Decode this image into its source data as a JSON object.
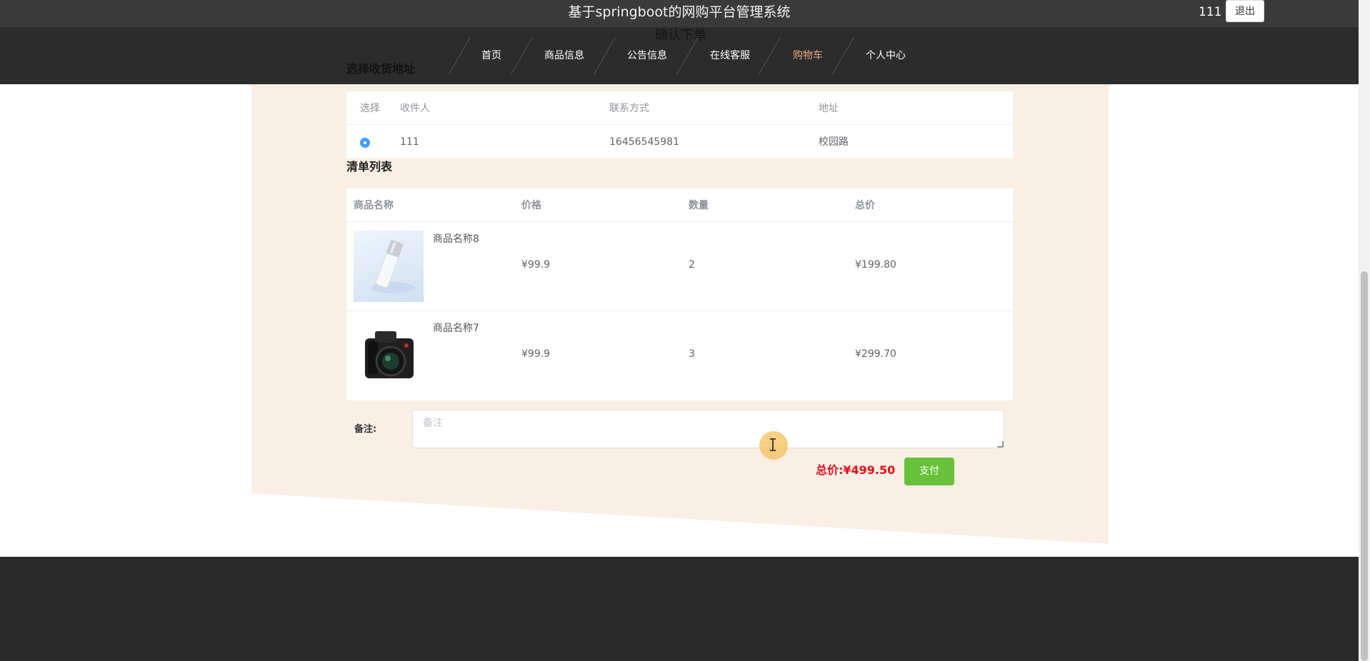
{
  "header": {
    "title": "基于springboot的网购平台管理系统",
    "username": "111",
    "logout_label": "退出"
  },
  "nav": {
    "items": [
      {
        "label": "首页"
      },
      {
        "label": "商品信息"
      },
      {
        "label": "公告信息"
      },
      {
        "label": "在线客服"
      },
      {
        "label": "购物车",
        "active": true
      },
      {
        "label": "个人中心"
      }
    ],
    "active_color": "#e9a97f",
    "ghost_heading": "确认下单"
  },
  "address_section": {
    "title": "选择收货地址",
    "columns": [
      "选择",
      "收件人",
      "联系方式",
      "地址"
    ],
    "rows": [
      {
        "selected": true,
        "recipient": "111",
        "phone": "16456545981",
        "address": "校园路"
      }
    ]
  },
  "order_section": {
    "title": "清单列表",
    "columns": [
      "商品名称",
      "价格",
      "数量",
      "总价"
    ],
    "items": [
      {
        "name": "商品名称8",
        "price": "¥99.9",
        "quantity": "2",
        "total": "¥199.80",
        "image": "bottle-product-image"
      },
      {
        "name": "商品名称7",
        "price": "¥99.9",
        "quantity": "3",
        "total": "¥299.70",
        "image": "camera-product-image"
      }
    ]
  },
  "remark": {
    "label": "备注:",
    "placeholder": "备注",
    "value": ""
  },
  "summary": {
    "total_label": "总价:",
    "total_value": "¥499.50",
    "total_text": "总价:¥499.50",
    "pay_label": "支付",
    "pay_color": "#67c23a",
    "total_color": "#e4101b"
  }
}
